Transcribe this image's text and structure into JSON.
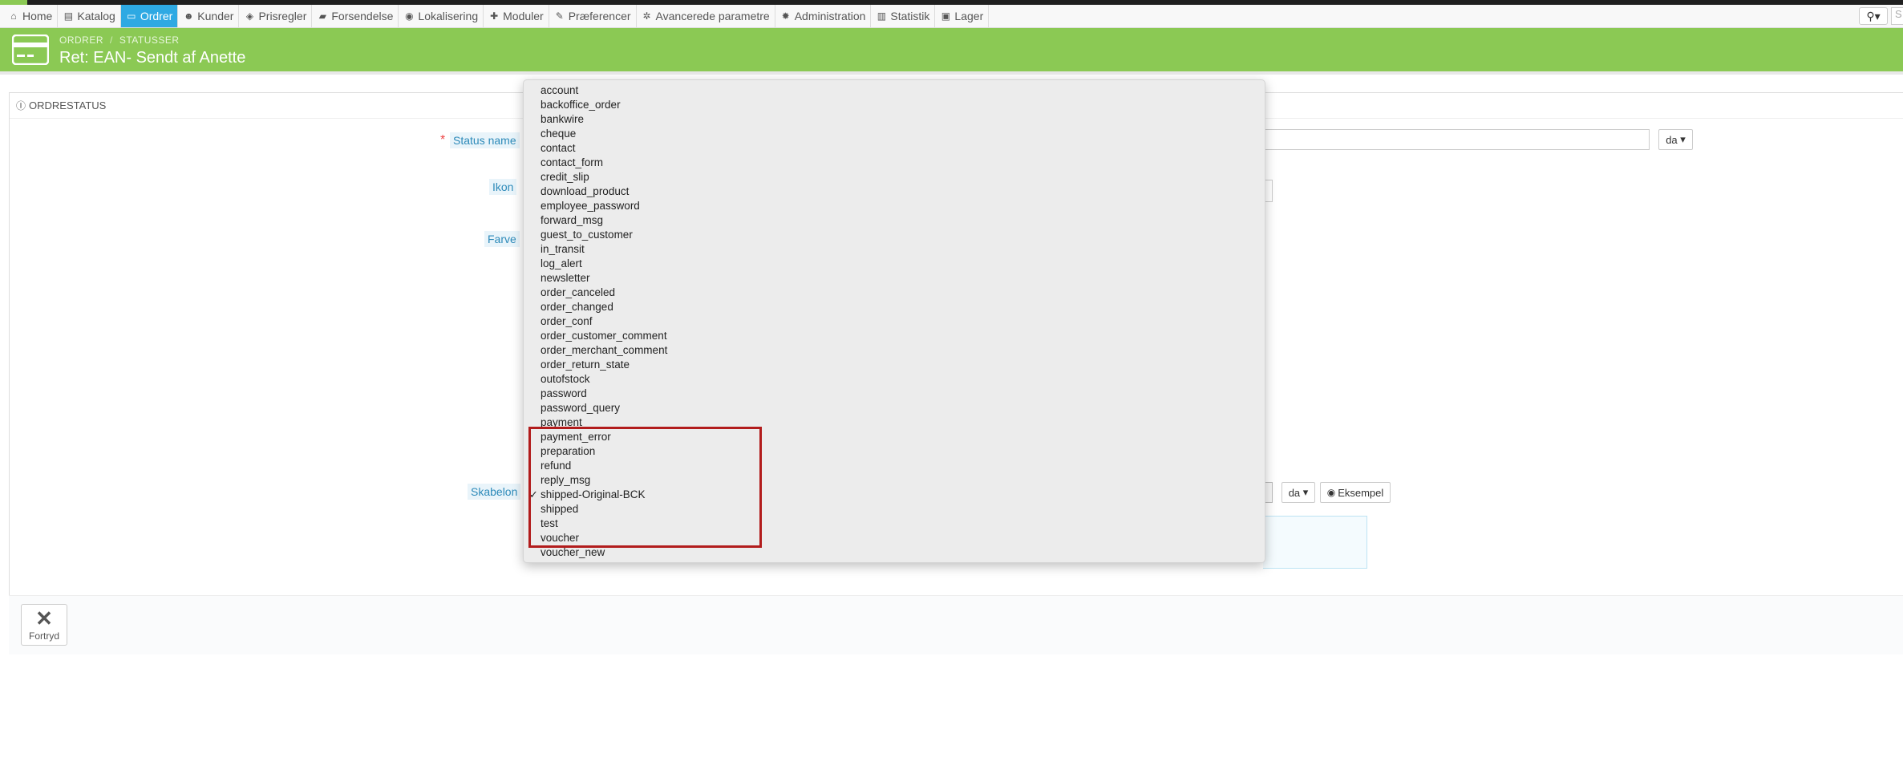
{
  "nav": {
    "items": [
      {
        "label": "Home",
        "icon": "dashboard-icon",
        "glyph": "⌂",
        "active": false
      },
      {
        "label": "Katalog",
        "icon": "book-icon",
        "glyph": "▤",
        "active": false
      },
      {
        "label": "Ordrer",
        "icon": "credit-card-icon",
        "glyph": "▭",
        "active": true
      },
      {
        "label": "Kunder",
        "icon": "users-icon",
        "glyph": "☻",
        "active": false
      },
      {
        "label": "Prisregler",
        "icon": "tags-icon",
        "glyph": "◈",
        "active": false
      },
      {
        "label": "Forsendelse",
        "icon": "truck-icon",
        "glyph": "▰",
        "active": false
      },
      {
        "label": "Lokalisering",
        "icon": "globe-icon",
        "glyph": "◉",
        "active": false
      },
      {
        "label": "Moduler",
        "icon": "puzzle-icon",
        "glyph": "✚",
        "active": false
      },
      {
        "label": "Præferencer",
        "icon": "wrench-icon",
        "glyph": "✎",
        "active": false
      },
      {
        "label": "Avancerede parametre",
        "icon": "cogs-icon",
        "glyph": "✲",
        "active": false
      },
      {
        "label": "Administration",
        "icon": "cog-icon",
        "glyph": "✹",
        "active": false
      },
      {
        "label": "Statistik",
        "icon": "bar-chart-icon",
        "glyph": "▥",
        "active": false
      },
      {
        "label": "Lager",
        "icon": "archive-icon",
        "glyph": "▣",
        "active": false
      }
    ],
    "search_glyph": "⚲▾",
    "search_stub": "S"
  },
  "header": {
    "breadcrumb": [
      "ORDRER",
      "STATUSSER"
    ],
    "breadcrumb_sep": "/",
    "title": "Ret: EAN- Sendt af Anette",
    "accent": "#8bc954"
  },
  "panel": {
    "title": "ORDRESTATUS",
    "icon": "info-circle-icon",
    "labels": {
      "status_name": "Status name",
      "ikon": "Ikon",
      "farve": "Farve",
      "skabelon": "Skabelon"
    },
    "required_mark": "*",
    "lang": "da",
    "preview_label": "Eksempel",
    "cancel_label": "Fortryd"
  },
  "dropdown": {
    "options": [
      "account",
      "backoffice_order",
      "bankwire",
      "cheque",
      "contact",
      "contact_form",
      "credit_slip",
      "download_product",
      "employee_password",
      "forward_msg",
      "guest_to_customer",
      "in_transit",
      "log_alert",
      "newsletter",
      "order_canceled",
      "order_changed",
      "order_conf",
      "order_customer_comment",
      "order_merchant_comment",
      "order_return_state",
      "outofstock",
      "password",
      "password_query",
      "payment",
      "payment_error",
      "preparation",
      "refund",
      "reply_msg",
      "shipped-Original-BCK",
      "shipped",
      "test",
      "voucher",
      "voucher_new"
    ],
    "selected": "shipped-Original-BCK",
    "check_glyph": "✓",
    "highlight_color": "#b21c1c"
  }
}
